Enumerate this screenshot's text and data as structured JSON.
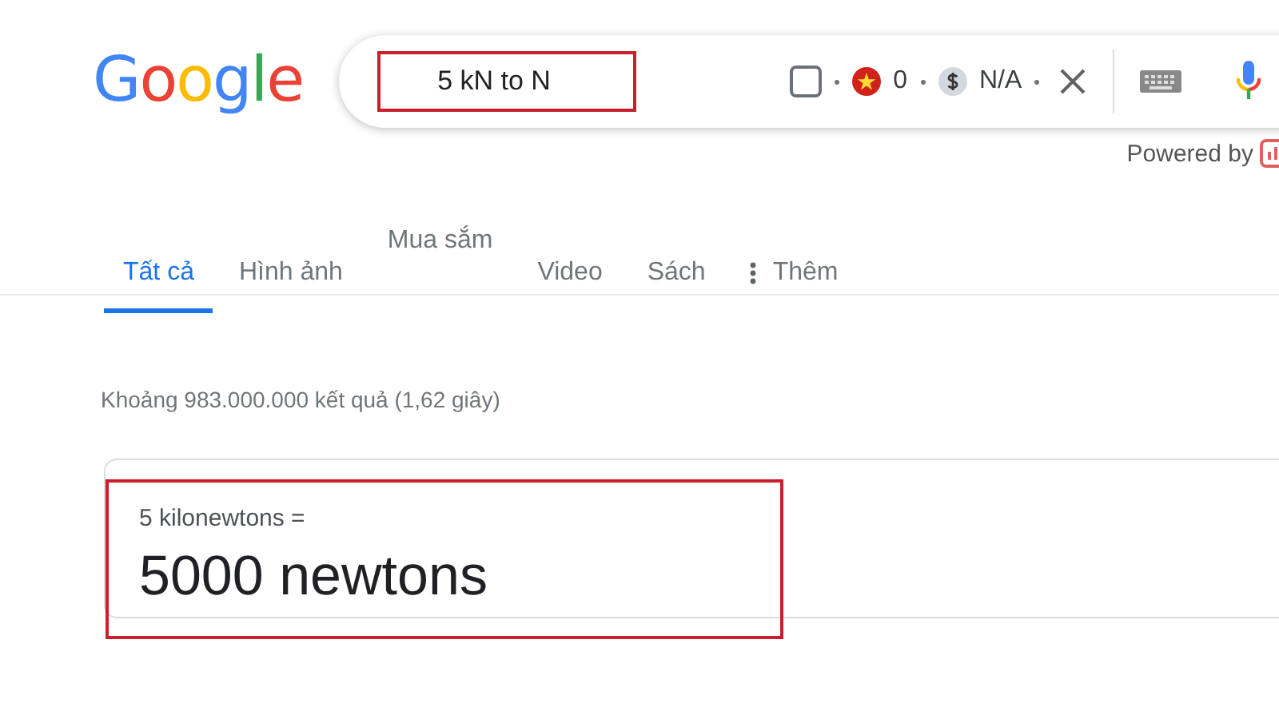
{
  "logo": "Google",
  "search": {
    "value": "5 kN to N",
    "highlighted": true,
    "checked": false,
    "badge_count": "0",
    "price": "N/A"
  },
  "powered_by": "Powered by",
  "tabs": [
    {
      "label": "Tất cả",
      "selected": true,
      "kind": "normal"
    },
    {
      "label": "Hình ảnh",
      "selected": false,
      "kind": "normal"
    },
    {
      "label": "Mua sắm",
      "selected": false,
      "kind": "raised"
    },
    {
      "label": "Video",
      "selected": false,
      "kind": "normal"
    },
    {
      "label": "Sách",
      "selected": false,
      "kind": "normal"
    },
    {
      "label": "Thêm",
      "selected": false,
      "kind": "more"
    }
  ],
  "result_stats": "Khoảng 983.000.000 kết quả (1,62 giây)",
  "answer": {
    "from": "5 kilonewtons =",
    "to": "5000 newtons",
    "highlighted": true
  }
}
